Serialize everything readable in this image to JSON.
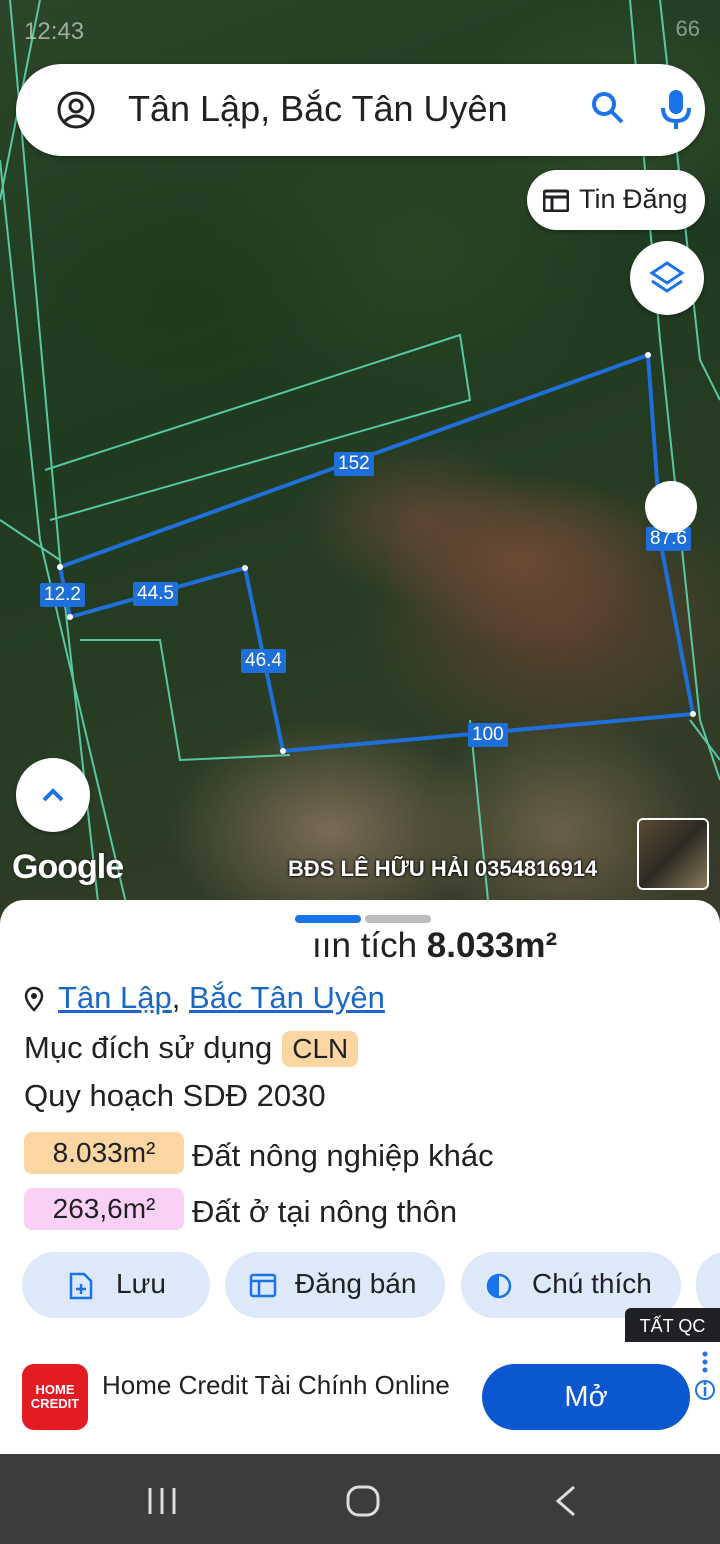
{
  "status_bar": {
    "time": "12:43",
    "battery": "66"
  },
  "search": {
    "query": "Tân Lập, Bắc Tân Uyên"
  },
  "listing_button": {
    "label": "Tin Đăng"
  },
  "map": {
    "attribution": "Google",
    "watermark": "BĐS LÊ HỮU HẢI 0354816914",
    "dimensions": [
      "152",
      "87.6",
      "100",
      "46.4",
      "44.5",
      "12.2"
    ]
  },
  "sheet": {
    "area_prefix": "ıın tích",
    "area_value": "8.033m²",
    "location": [
      "Tân Lập",
      "Bắc Tân Uyên"
    ],
    "location_sep": ",",
    "usage_label": "Mục đích sử dụng",
    "usage_code": "CLN",
    "plan_label": "Quy hoạch SDĐ 2030",
    "plan_items": [
      {
        "value": "8.033m²",
        "label": "Đất nông nghiệp khác",
        "color": "#fbd6a2"
      },
      {
        "value": "263,6m²",
        "label": "Đất ở tại nông thôn",
        "color": "#fbd0f5"
      }
    ],
    "actions": [
      "Lưu",
      "Đăng bán",
      "Chú thích"
    ]
  },
  "ad": {
    "close_label": "TẤT QC",
    "logo_text": "HOME CREDIT",
    "title": "Home Credit Tài Chính Online",
    "cta": "Mở"
  },
  "colors": {
    "accent": "#1e6fd9",
    "cta": "#0b57d0"
  }
}
